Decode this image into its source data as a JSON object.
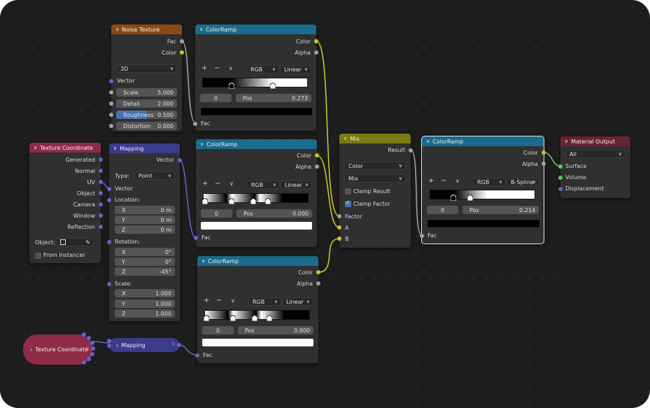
{
  "nodes": {
    "noise": {
      "title": "Noise Texture",
      "outputs": [
        "Fac",
        "Color"
      ],
      "dimensions": "3D",
      "input_vector": "Vector",
      "fields": [
        {
          "label": "Scale",
          "value": "5.000"
        },
        {
          "label": "Detail",
          "value": "2.000"
        },
        {
          "label": "Roughness",
          "value": "0.500"
        },
        {
          "label": "Distortion",
          "value": "0.000"
        }
      ]
    },
    "ramp1": {
      "title": "ColorRamp",
      "outputs": [
        "Color",
        "Alpha"
      ],
      "color_mode": "RGB",
      "interpolation": "Linear",
      "stop_index": "0",
      "pos_label": "Pos",
      "pos_value": "0.273",
      "input": "Fac",
      "swatch_color": "#000000"
    },
    "ramp2": {
      "title": "ColorRamp",
      "outputs": [
        "Color",
        "Alpha"
      ],
      "color_mode": "RGB",
      "interpolation": "Linear",
      "stop_index": "0",
      "pos_label": "Pos",
      "pos_value": "0.000",
      "input": "Fac",
      "swatch_color": "#ffffff"
    },
    "ramp3": {
      "title": "ColorRamp",
      "outputs": [
        "Color",
        "Alpha"
      ],
      "color_mode": "RGB",
      "interpolation": "Linear",
      "stop_index": "0",
      "pos_label": "Pos",
      "pos_value": "0.000",
      "input": "Fac",
      "swatch_color": "#ffffff"
    },
    "ramp4": {
      "title": "ColorRamp",
      "outputs": [
        "Color",
        "Alpha"
      ],
      "color_mode": "RGB",
      "interpolation": "B-Spline",
      "stop_index": "0",
      "pos_label": "Pos",
      "pos_value": "0.214",
      "input": "Fac",
      "swatch_color": "#000000"
    },
    "texcoord": {
      "title": "Texture Coordinate",
      "outputs": [
        "Generated",
        "Normal",
        "UV",
        "Object",
        "Camera",
        "Window",
        "Reflection"
      ],
      "object_label": "Object:",
      "from_instancer": "From Instancer"
    },
    "mapping": {
      "title": "Mapping",
      "output": "Vector",
      "type_label": "Type:",
      "type_value": "Point",
      "input_vector": "Vector",
      "location_label": "Location:",
      "location": [
        {
          "axis": "X",
          "value": "0 m"
        },
        {
          "axis": "Y",
          "value": "0 m"
        },
        {
          "axis": "Z",
          "value": "0 m"
        }
      ],
      "rotation_label": "Rotation:",
      "rotation": [
        {
          "axis": "X",
          "value": "0°"
        },
        {
          "axis": "Y",
          "value": "0°"
        },
        {
          "axis": "Z",
          "value": "-45°"
        }
      ],
      "scale_label": "Scale:",
      "scale": [
        {
          "axis": "X",
          "value": "1.000"
        },
        {
          "axis": "Y",
          "value": "1.000"
        },
        {
          "axis": "Z",
          "value": "1.000"
        }
      ]
    },
    "mix": {
      "title": "Mix",
      "output": "Result",
      "data_type": "Color",
      "blend": "Mix",
      "clamp_result": "Clamp Result",
      "clamp_factor": "Clamp Factor",
      "clamp_result_checked": false,
      "clamp_factor_checked": true,
      "inputs": [
        "Factor",
        "A",
        "B"
      ]
    },
    "output": {
      "title": "Material Output",
      "target": "All",
      "inputs": [
        "Surface",
        "Volume",
        "Displacement"
      ]
    },
    "collapsed_texcoord": {
      "title": "Texture Coordinate"
    },
    "collapsed_mapping": {
      "title": "Mapping"
    }
  },
  "colors": {
    "wire_yellow": "#c7c729",
    "wire_gray": "#a1a1a1",
    "wire_purple": "#6363c7",
    "wire_green": "#63c763"
  }
}
